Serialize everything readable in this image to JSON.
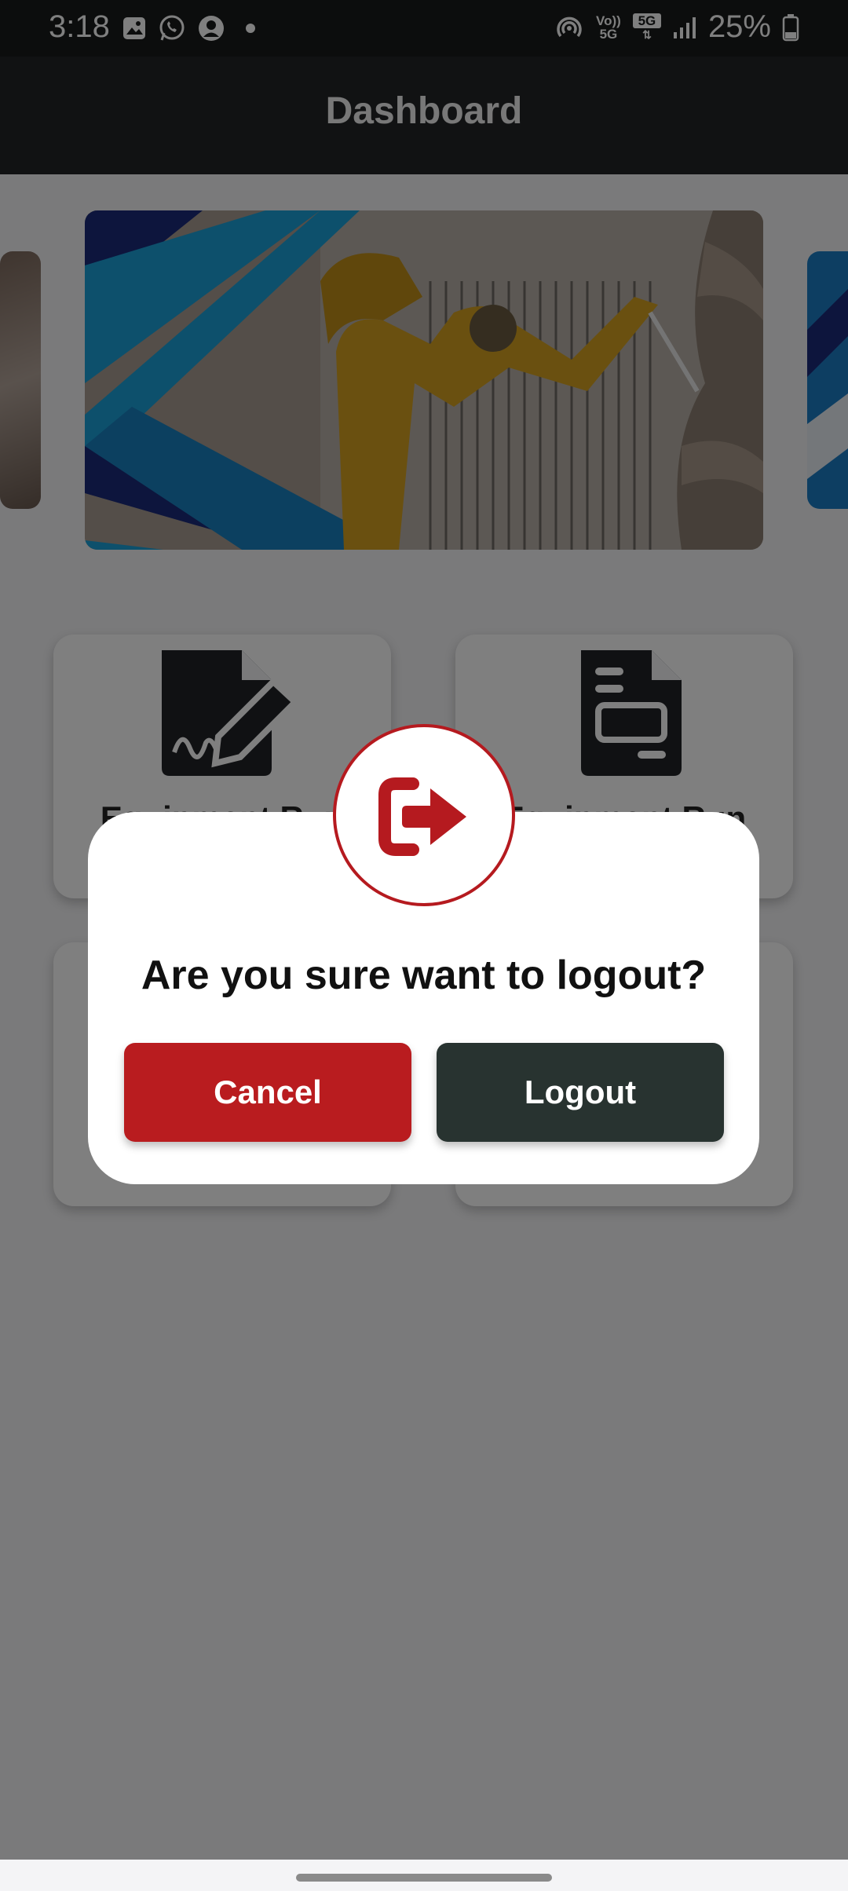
{
  "status_bar": {
    "time": "3:18",
    "left_icons": [
      "gallery-icon",
      "whatsapp-icon",
      "account-icon",
      "dot-icon"
    ],
    "right_icons": [
      "hotspot-icon",
      "volte-icon",
      "5g-icon",
      "signal-icon",
      "battery-icon"
    ],
    "volte_label": "Vo)) 5G",
    "network_label": "5G",
    "battery": "25%"
  },
  "app_bar": {
    "title": "Dashboard"
  },
  "carousel": {
    "slide_count": 5,
    "active_index": 4
  },
  "cards": [
    {
      "label": "Equipment Run",
      "icon": "signed-document-icon"
    },
    {
      "label": "Equipment Run",
      "icon": "document-icon"
    }
  ],
  "dialog": {
    "icon": "logout-icon",
    "message": "Are you sure want to logout?",
    "cancel_label": "Cancel",
    "logout_label": "Logout"
  },
  "colors": {
    "accent_red": "#b91c1f",
    "dark_button": "#283330",
    "app_bar": "#222426"
  }
}
